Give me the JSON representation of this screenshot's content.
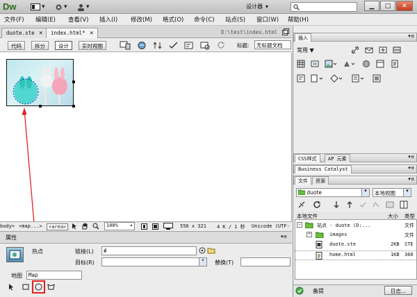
{
  "app": {
    "logo": "Dw",
    "workspace": "设计器",
    "search_placeholder": ""
  },
  "window": {
    "minimize": "▁",
    "maximize": "□",
    "close": "✕"
  },
  "menu": [
    "文件(F)",
    "编辑(E)",
    "查看(V)",
    "插入(I)",
    "修改(M)",
    "格式(O)",
    "命令(C)",
    "站点(S)",
    "窗口(W)",
    "帮助(H)"
  ],
  "doc_tabs": [
    {
      "label": "duote.ste",
      "close": "✕"
    },
    {
      "label": "index.html*",
      "close": "✕"
    }
  ],
  "doc_path": "D:\\test\\index.html",
  "view_buttons": [
    "代码",
    "拆分",
    "设计",
    "实时视图"
  ],
  "title_label": "标题:",
  "title_value": "无标题文档",
  "status": {
    "tags": [
      "body>",
      "<map...>",
      "<area>"
    ],
    "zoom": "100%",
    "dimensions": "556 x 321",
    "size": "4 K / 1 秒",
    "encoding": "Unicode (UTF-"
  },
  "properties": {
    "panel_title": "属性",
    "hotspot_label": "热点",
    "link_label": "链接(L)",
    "link_value": "#",
    "target_label": "目标(R)",
    "target_value": "",
    "alt_label": "替换(T)",
    "alt_value": "",
    "map_label": "地图",
    "map_value": "Map"
  },
  "right_panel": {
    "insert_tab": "插入",
    "insert_category": "常用",
    "css_tabs": [
      "CSS样式",
      "AP 元素"
    ],
    "bc_tab": "Business Catalyst",
    "files_tabs": [
      "文件",
      "资源"
    ],
    "site_select": "duote",
    "view_select": "本地视图",
    "file_headers": [
      "本地文件",
      "大小",
      "类型"
    ],
    "files": [
      {
        "name": "站点 - duote (D:...",
        "size": "",
        "type": "文件"
      },
      {
        "name": "images",
        "size": "",
        "type": "文件"
      },
      {
        "name": "duote.ste",
        "size": "2KB",
        "type": "STE"
      },
      {
        "name": "home.html",
        "size": "1KB",
        "type": "360"
      }
    ],
    "bottom_label": "备提",
    "log_button": "日志..."
  },
  "colors": {
    "logo": "#2d6c1d",
    "arrow": "#e02020",
    "highlight": "#e02020"
  }
}
